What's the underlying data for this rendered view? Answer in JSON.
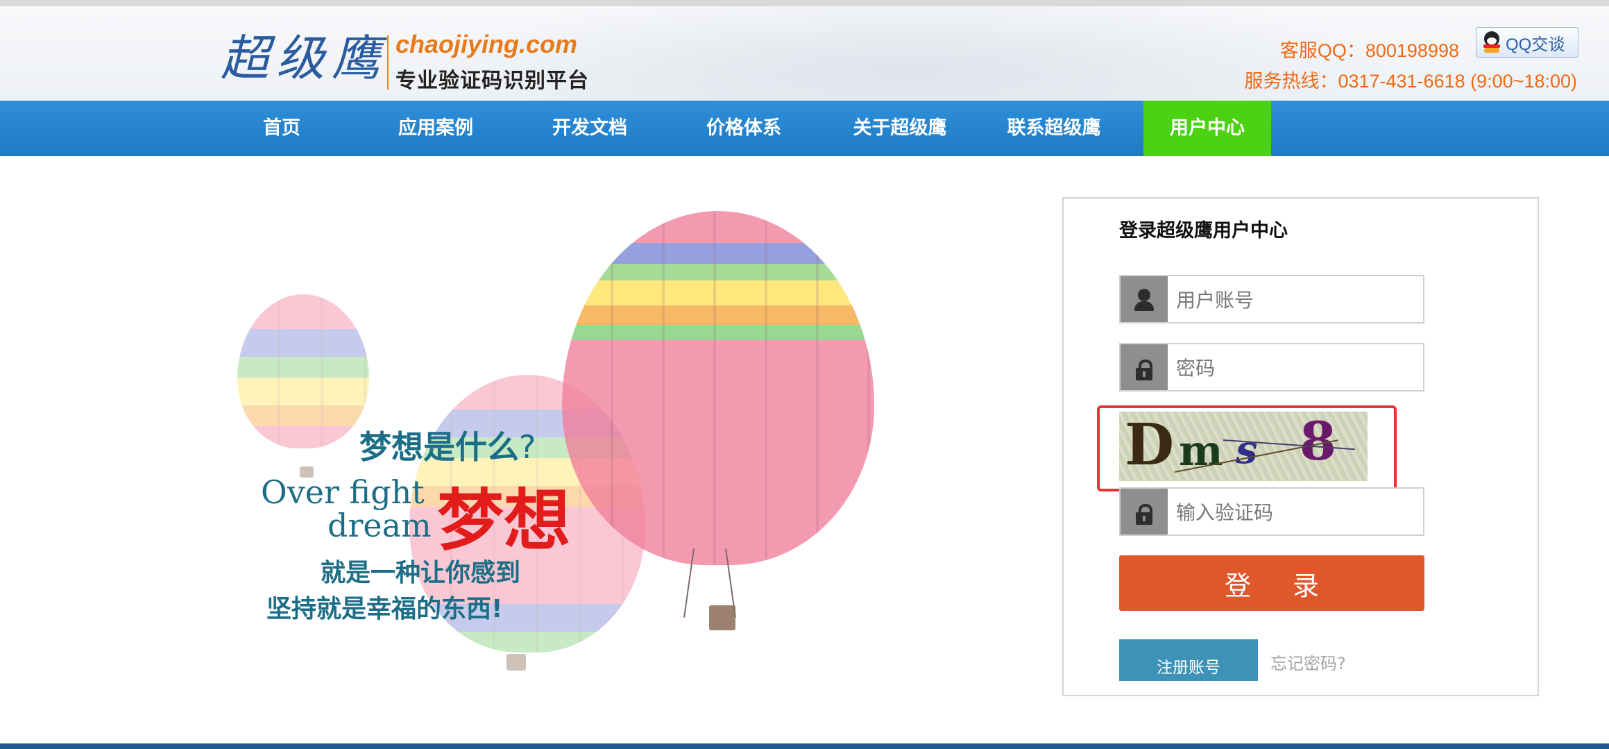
{
  "header": {
    "logo_cn": "超级鹰",
    "logo_en": "chaojiying.com",
    "slogan": "专业验证码识别平台",
    "qq_line": "客服QQ：800198998",
    "hotline": "服务热线：0317-431-6618 (9:00~18:00)",
    "qq_button_label": "QQ交谈"
  },
  "nav": {
    "items": [
      {
        "label": "首页"
      },
      {
        "label": "应用案例"
      },
      {
        "label": "开发文档"
      },
      {
        "label": "价格体系"
      },
      {
        "label": "关于超级鹰"
      },
      {
        "label": "联系超级鹰"
      },
      {
        "label": "用户中心",
        "active": true
      }
    ],
    "bar_color": "#2285cf",
    "active_color": "#4bd212"
  },
  "hero": {
    "line1": "梦想是什么",
    "line1_q": "?",
    "line2_en_1": "Over fight",
    "line2_en_2": "dream",
    "line2_big": "梦想",
    "line3": "就是一种让你感到",
    "line4": "坚持就是幸福的东西",
    "line4_end": "!"
  },
  "login": {
    "title": "登录超级鹰用户中心",
    "username_placeholder": "用户账号",
    "password_placeholder": "密码",
    "captcha_text": "Dms8",
    "captcha_placeholder": "输入验证码",
    "login_button": "登 录",
    "register_button": "注册账号",
    "forgot_link": "忘记密码?",
    "login_button_color": "#e0572b",
    "register_button_color": "#3d92b6",
    "highlight_color": "#e53434"
  }
}
